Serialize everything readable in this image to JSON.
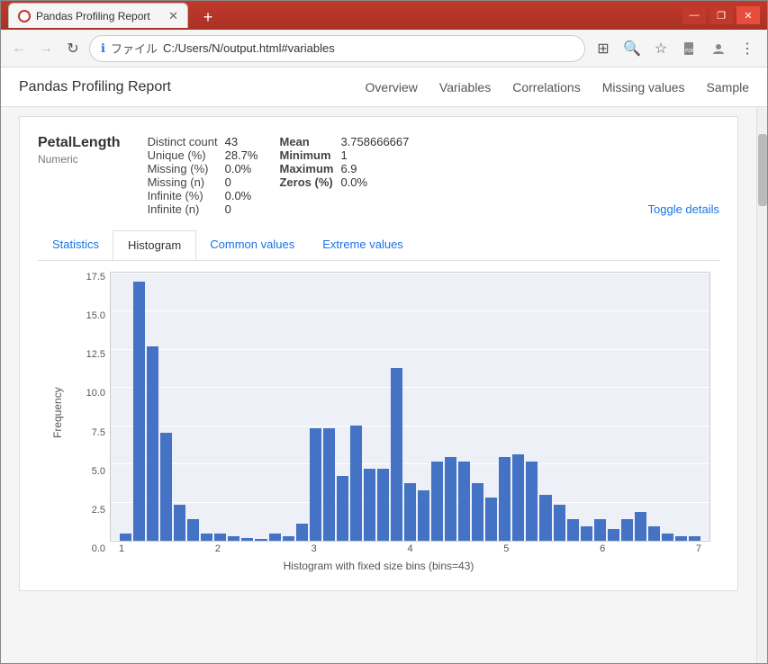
{
  "window": {
    "title": "Pandas Profiling Report",
    "controls": {
      "minimize": "—",
      "restore": "❐",
      "close": "✕"
    }
  },
  "tab": {
    "label": "Pandas Profiling Report",
    "close": "✕",
    "add": "+"
  },
  "address_bar": {
    "back": "←",
    "forward": "→",
    "refresh": "↻",
    "info_label": "ファイル",
    "url": "C:/Users/N/output.html#variables",
    "icons": {
      "translate": "⊞",
      "search": "🔍",
      "star": "☆",
      "pdf": "📄",
      "profile": "👤",
      "menu": "⋮"
    }
  },
  "page_nav": {
    "brand": "Pandas Profiling Report",
    "links": [
      "Overview",
      "Variables",
      "Correlations",
      "Missing values",
      "Sample"
    ]
  },
  "variable": {
    "name": "PetalLength",
    "type": "Numeric",
    "stats": {
      "distinct_count_label": "Distinct count",
      "distinct_count_value": "43",
      "unique_label": "Unique (%)",
      "unique_value": "28.7%",
      "missing_pct_label": "Missing (%)",
      "missing_pct_value": "0.0%",
      "missing_n_label": "Missing (n)",
      "missing_n_value": "0",
      "infinite_pct_label": "Infinite (%)",
      "infinite_pct_value": "0.0%",
      "infinite_n_label": "Infinite (n)",
      "infinite_n_value": "0",
      "mean_label": "Mean",
      "mean_value": "3.758666667",
      "minimum_label": "Minimum",
      "minimum_value": "1",
      "maximum_label": "Maximum",
      "maximum_value": "6.9",
      "zeros_label": "Zeros (%)",
      "zeros_value": "0.0%"
    },
    "toggle_details": "Toggle details"
  },
  "tabs": {
    "statistics": "Statistics",
    "histogram": "Histogram",
    "common_values": "Common values",
    "extreme_values": "Extreme values"
  },
  "histogram": {
    "y_label": "Frequency",
    "y_axis": [
      "17.5",
      "15.0",
      "12.5",
      "10.0",
      "7.5",
      "5.0",
      "2.5",
      "0.0"
    ],
    "x_axis": [
      "1",
      "2",
      "3",
      "4",
      "5",
      "6",
      "7"
    ],
    "caption": "Histogram with fixed size bins (bins=43)",
    "bars": [
      0.5,
      18,
      13.5,
      7.5,
      2.5,
      1.5,
      0.5,
      0.5,
      0.3,
      0.2,
      0.1,
      0.5,
      0.3,
      1.2,
      7.8,
      7.8,
      4.5,
      8,
      5,
      5,
      12,
      4,
      3.5,
      5.5,
      5.8,
      5.5,
      4,
      3,
      5.8,
      6,
      5.5,
      3.2,
      2.5,
      1.5,
      1,
      1.5,
      0.8,
      1.5,
      2,
      1,
      0.5,
      0.3,
      0.3
    ]
  }
}
